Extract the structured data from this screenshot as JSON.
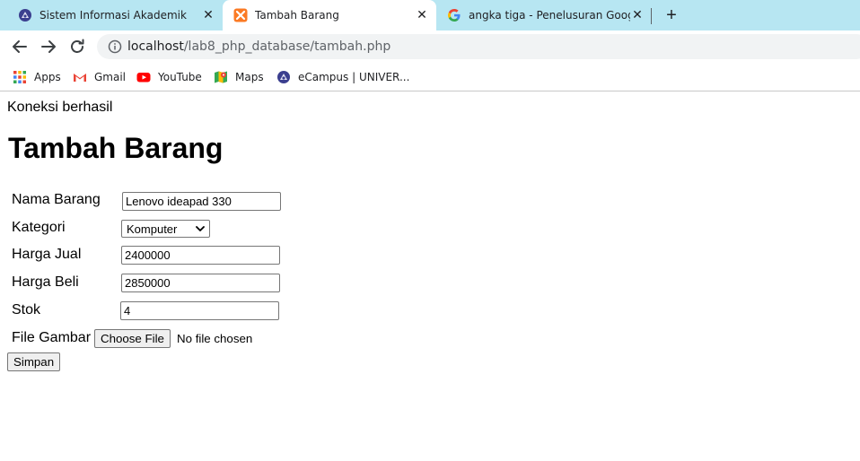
{
  "browser": {
    "tabs": [
      {
        "title": "Sistem Informasi Akademik",
        "active": false,
        "icon": "university-logo-icon"
      },
      {
        "title": "Tambah Barang",
        "active": true,
        "icon": "xampp-icon"
      },
      {
        "title": "angka tiga - Penelusuran Google",
        "active": false,
        "icon": "google-icon"
      }
    ],
    "close_glyph": "✕",
    "new_tab_glyph": "+",
    "url_host": "localhost",
    "url_path": "/lab8_php_database/tambah.php",
    "bookmarks": [
      {
        "label": "Apps",
        "icon": "apps-grid-icon"
      },
      {
        "label": "Gmail",
        "icon": "gmail-icon"
      },
      {
        "label": "YouTube",
        "icon": "youtube-icon"
      },
      {
        "label": "Maps",
        "icon": "maps-icon"
      },
      {
        "label": "eCampus | UNIVER...",
        "icon": "university-logo-icon"
      }
    ],
    "colors": {
      "tabstrip": "#b7e6f2",
      "omnibox": "#f1f3f4"
    }
  },
  "page": {
    "status": "Koneksi berhasil",
    "title": "Tambah Barang",
    "form": {
      "nama_label": "Nama Barang",
      "nama_value": "Lenovo ideapad 330",
      "kategori_label": "Kategori",
      "kategori_value": "Komputer",
      "harga_jual_label": "Harga Jual",
      "harga_jual_value": "2400000",
      "harga_beli_label": "Harga Beli",
      "harga_beli_value": "2850000",
      "stok_label": "Stok",
      "stok_value": "4",
      "file_label": "File Gambar",
      "file_button": "Choose File",
      "file_status": "No file chosen",
      "submit_label": "Simpan"
    }
  }
}
